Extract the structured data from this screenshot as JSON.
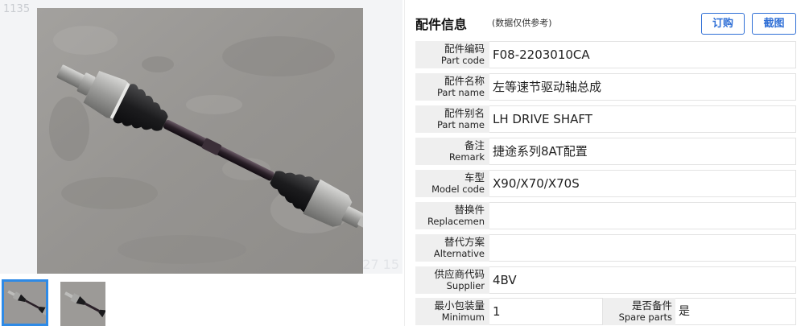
{
  "viewer": {
    "watermark_top": "1135",
    "watermark_bottom": "27  15",
    "main_image": "drive-shaft-photo",
    "thumbnails": [
      {
        "image": "drive-shaft-photo",
        "selected": true
      },
      {
        "image": "drive-shaft-photo",
        "selected": false
      }
    ]
  },
  "panel": {
    "title": "配件信息",
    "note": "(数据仅供参考)",
    "order_label": "订购",
    "screenshot_label": "截图",
    "rows": [
      {
        "label_cn": "配件编码",
        "label_en": "Part code",
        "value": "F08-2203010CA"
      },
      {
        "label_cn": "配件名称",
        "label_en": "Part name",
        "value": "左等速节驱动轴总成"
      },
      {
        "label_cn": "配件别名",
        "label_en": "Part name",
        "value": "LH DRIVE SHAFT"
      },
      {
        "label_cn": "备注",
        "label_en": "Remark",
        "value": "捷途系列8AT配置"
      },
      {
        "label_cn": "车型",
        "label_en": "Model code",
        "value": "X90/X70/X70S"
      },
      {
        "label_cn": "替换件",
        "label_en": "Replacemen",
        "value": ""
      },
      {
        "label_cn": "替代方案",
        "label_en": "Alternative",
        "value": ""
      },
      {
        "label_cn": "供应商代码",
        "label_en": "Supplier",
        "value": "4BV"
      }
    ],
    "last_row": {
      "label_cn": "最小包装量",
      "label_en": "Minimum",
      "value": "1",
      "label2_cn": "是否备件",
      "label2_en": "Spare parts",
      "value2": "是"
    }
  },
  "colors": {
    "accent": "#2f6fd6",
    "thumb_selected": "#2e8ae6",
    "label_bg": "#efefef",
    "concrete": "#9a9896"
  }
}
